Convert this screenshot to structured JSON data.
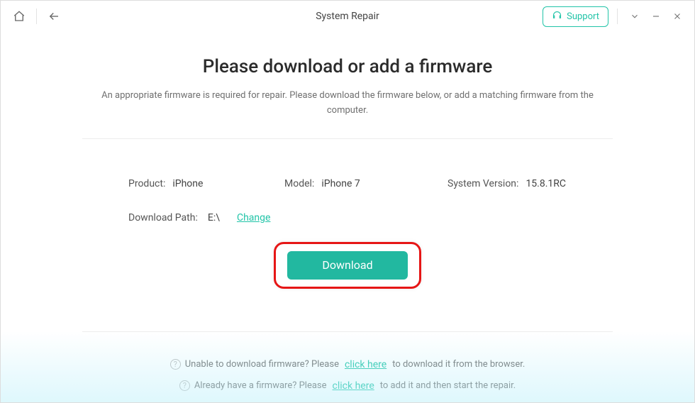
{
  "window": {
    "title": "System Repair",
    "support_label": "Support"
  },
  "heading": "Please download or add a firmware",
  "subheading": "An appropriate firmware is required for repair. Please download the firmware below, or add a matching firmware from the computer.",
  "device": {
    "product_label": "Product:",
    "product_value": "iPhone",
    "model_label": "Model:",
    "model_value": "iPhone 7",
    "version_label": "System Version:",
    "version_value": "15.8.1RC"
  },
  "path": {
    "label": "Download Path:",
    "value": "E:\\",
    "change_label": "Change"
  },
  "download_button": "Download",
  "help": {
    "line1_pre": "Unable to download firmware? Please",
    "line1_link": "click here",
    "line1_post": "to download it from the browser.",
    "line2_pre": "Already have a firmware? Please",
    "line2_link": "click here",
    "line2_post": "to add it and then start the repair."
  }
}
